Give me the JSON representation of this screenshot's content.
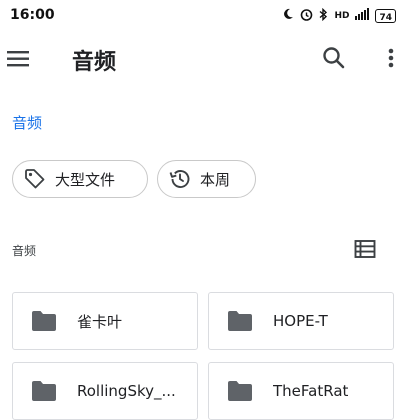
{
  "status": {
    "time": "16:00",
    "signal_label": "HD",
    "battery": "74",
    "icons": [
      "moon-icon",
      "alarm-icon",
      "bluetooth-icon",
      "hd-icon",
      "signal-icon",
      "battery-icon"
    ]
  },
  "app_bar": {
    "title": "音频",
    "icons": [
      "menu-icon",
      "search-icon",
      "more-vert-icon"
    ]
  },
  "breadcrumb": "音频",
  "chips": [
    {
      "label": "大型文件",
      "icon": "tag-icon"
    },
    {
      "label": "本周",
      "icon": "history-icon"
    }
  ],
  "section": {
    "label": "音频",
    "view_icon": "list-view-icon"
  },
  "folders": [
    {
      "name": "雀卡叶",
      "icon": "folder-icon"
    },
    {
      "name": "HOPE-T",
      "icon": "folder-icon"
    },
    {
      "name": "RollingSky_...",
      "icon": "folder-icon"
    },
    {
      "name": "TheFatRat",
      "icon": "folder-icon"
    }
  ],
  "colors": {
    "accent": "#1a73e8",
    "folder": "#5f6368",
    "border": "#dadce0"
  }
}
